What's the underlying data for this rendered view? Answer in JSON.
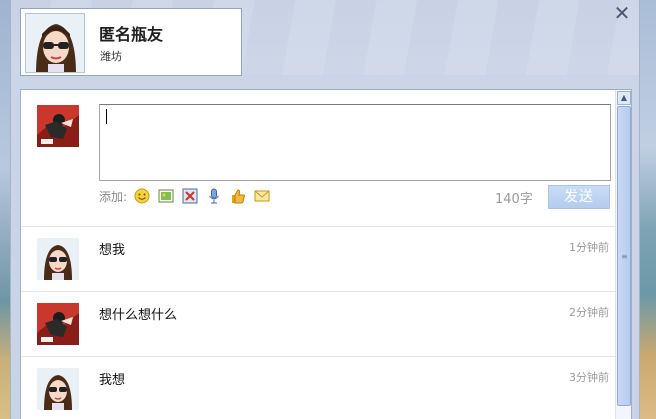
{
  "profile": {
    "name": "匿名瓶友",
    "location": "潍坊"
  },
  "compose": {
    "add_label": "添加:",
    "char_count": "140字",
    "send_label": "发送",
    "input_value": "",
    "tools": [
      "smiley-icon",
      "image-icon",
      "video-icon",
      "microphone-icon",
      "thumbs-up-icon",
      "envelope-icon"
    ]
  },
  "messages": [
    {
      "text": "想我",
      "time": "1分钟前",
      "avatar": "girl-avatar"
    },
    {
      "text": "想什么想什么",
      "time": "2分钟前",
      "avatar": "comic-avatar"
    },
    {
      "text": "我想",
      "time": "3分钟前",
      "avatar": "girl-avatar"
    }
  ],
  "colors": {
    "dialog_bg": "#c9d3e5",
    "send_button": "#b8d0f0",
    "panel_border": "#9fb0c9"
  }
}
